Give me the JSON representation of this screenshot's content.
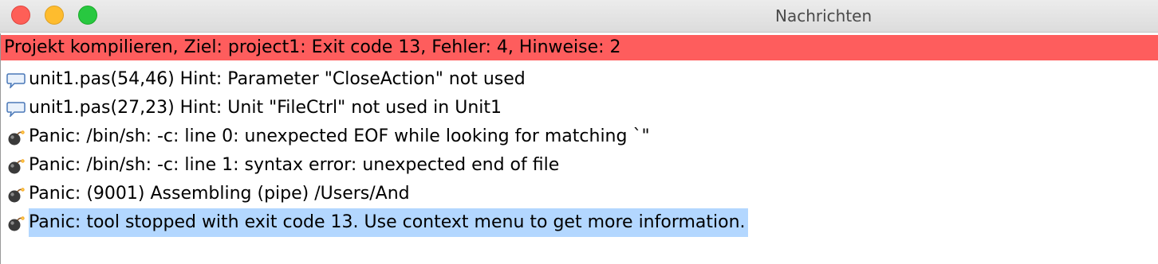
{
  "window": {
    "title": "Nachrichten"
  },
  "summary": "Projekt kompilieren, Ziel: project1: Exit code 13, Fehler: 4, Hinweise: 2",
  "messages": [
    {
      "icon": "hint-speech-bubble-icon",
      "text": "unit1.pas(54,46) Hint: Parameter \"CloseAction\" not used"
    },
    {
      "icon": "hint-speech-bubble-icon",
      "text": "unit1.pas(27,23) Hint: Unit \"FileCtrl\" not used in Unit1"
    },
    {
      "icon": "panic-bomb-icon",
      "text": "Panic: /bin/sh: -c: line 0: unexpected EOF while looking for matching `\""
    },
    {
      "icon": "panic-bomb-icon",
      "text": "Panic: /bin/sh: -c: line 1: syntax error: unexpected end of file"
    },
    {
      "icon": "panic-bomb-icon",
      "text": "Panic: (9001) Assembling (pipe) /Users/And"
    },
    {
      "icon": "panic-bomb-icon",
      "text": "Panic: tool stopped with exit code 13. Use context menu to get more information.",
      "selected": true
    }
  ],
  "colors": {
    "summary_bg": "#fe5d5d",
    "selection_bg": "#b3d7ff"
  }
}
